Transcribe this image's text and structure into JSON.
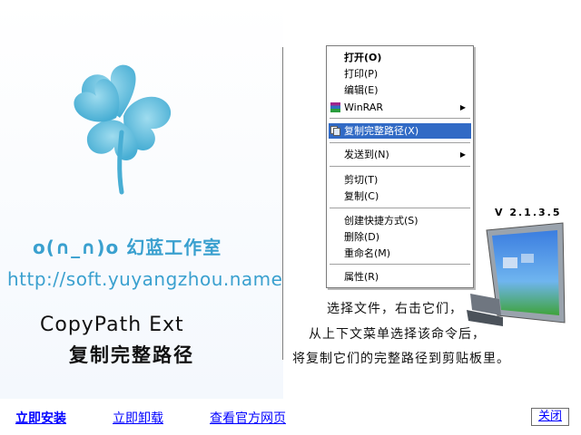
{
  "splash": {
    "studio": "o(∩_∩)o 幻蓝工作室",
    "url": "http://soft.yuyangzhou.name",
    "product_name": "CopyPath Ext",
    "product_name_cn": "复制完整路径",
    "version": "V 2.1.3.5",
    "clover_icon": "four-leaf-clover-icon",
    "monitor_icon": "lcd-monitor-icon"
  },
  "context_menu": {
    "items": [
      {
        "label": "打开(O)",
        "bold": true
      },
      {
        "label": "打印(P)"
      },
      {
        "label": "编辑(E)"
      },
      {
        "label": "WinRAR",
        "submenu": true,
        "icon": "winrar-icon"
      },
      {
        "separator": true
      },
      {
        "label": "复制完整路径(X)",
        "highlighted": true,
        "icon": "copypath-icon"
      },
      {
        "separator": true
      },
      {
        "label": "发送到(N)",
        "submenu": true
      },
      {
        "separator": true
      },
      {
        "label": "剪切(T)"
      },
      {
        "label": "复制(C)"
      },
      {
        "separator": true
      },
      {
        "label": "创建快捷方式(S)"
      },
      {
        "label": "删除(D)"
      },
      {
        "label": "重命名(M)"
      },
      {
        "separator": true
      },
      {
        "label": "属性(R)"
      }
    ]
  },
  "description": {
    "line1": "选择文件，右击它们，",
    "line2": "从上下文菜单选择该命令后，",
    "line3": "将复制它们的完整路径到剪贴板里。"
  },
  "bottom": {
    "install": "立即安装",
    "uninstall": "立即卸载",
    "website": "查看官方网页",
    "close": "关闭"
  },
  "colors": {
    "accent": "#3aa0cf",
    "highlight": "#316ac5",
    "link": "#0000ff"
  }
}
